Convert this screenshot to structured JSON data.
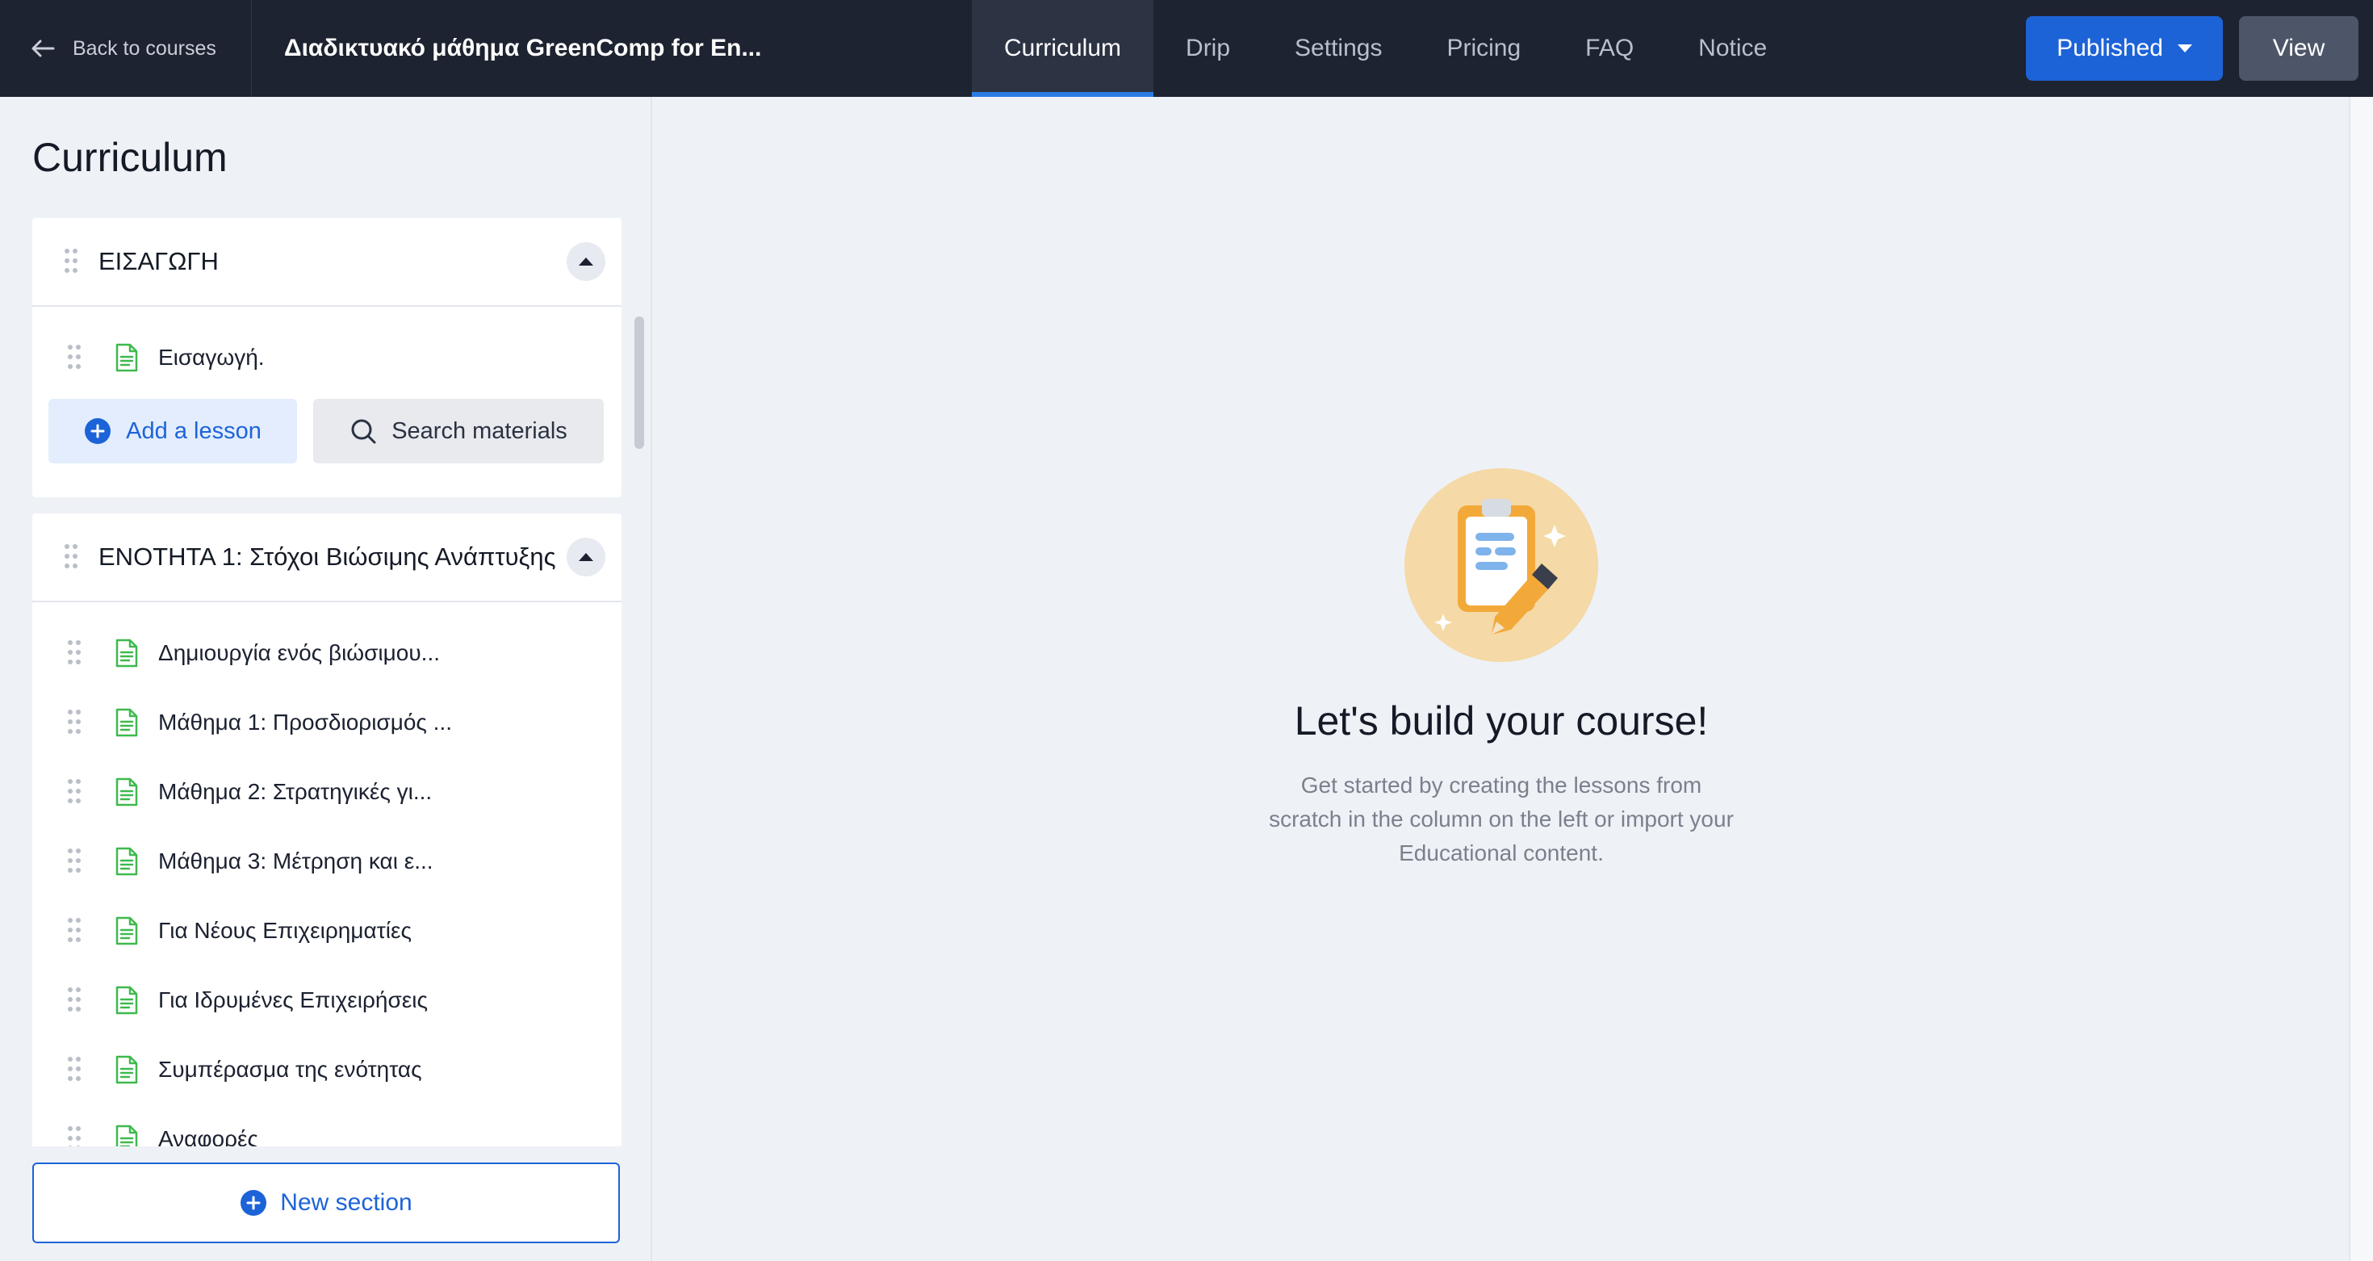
{
  "header": {
    "back_label": "Back to courses",
    "course_title": "Διαδικτυακό μάθημα GreenComp for En...",
    "tabs": [
      {
        "label": "Curriculum",
        "active": true
      },
      {
        "label": "Drip",
        "active": false
      },
      {
        "label": "Settings",
        "active": false
      },
      {
        "label": "Pricing",
        "active": false
      },
      {
        "label": "FAQ",
        "active": false
      },
      {
        "label": "Notice",
        "active": false
      }
    ],
    "published_label": "Published",
    "view_label": "View"
  },
  "sidebar": {
    "title": "Curriculum",
    "sections": [
      {
        "title": "ΕΙΣΑΓΩΓΗ",
        "lessons": [
          "Εισαγωγή."
        ],
        "add_lesson_label": "Add a lesson",
        "search_materials_label": "Search materials"
      },
      {
        "title": "ΕΝΟΤΗΤΑ 1: Στόχοι Βιώσιμης Ανάπτυξης",
        "lessons": [
          "Δημιουργία ενός βιώσιμου...",
          "Μάθημα 1: Προσδιορισμός ...",
          "Μάθημα 2: Στρατηγικές γι...",
          "Μάθημα 3: Μέτρηση και ε...",
          "Για Νέους Επιχειρηματίες",
          "Για Ιδρυμένες Επιχειρήσεις",
          "Συμπέρασμα της ενότητας",
          "Αναφορές"
        ]
      }
    ],
    "new_section_label": "New section"
  },
  "main": {
    "empty_title": "Let's build your course!",
    "empty_description": "Get started by creating the lessons from scratch in the column on the left or import your Educational content."
  },
  "colors": {
    "topbar": "#1d2330",
    "accent": "#1d63d8",
    "lesson_icon": "#3fb94f"
  },
  "icons": {
    "back": "arrow-left-icon",
    "drag": "drag-handle-icon",
    "lesson": "document-icon",
    "add": "plus-circle-icon",
    "search": "search-icon",
    "collapse": "chevron-up-icon",
    "dropdown": "caret-down-icon"
  }
}
